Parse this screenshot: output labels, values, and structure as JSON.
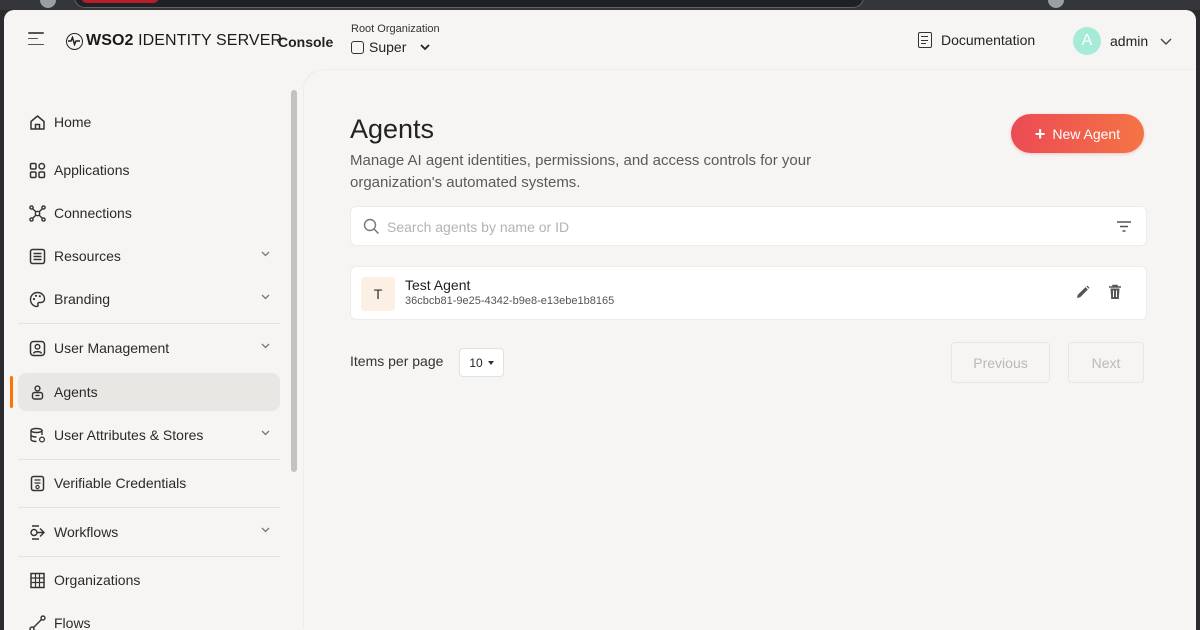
{
  "header": {
    "brand_strong": "WSO2",
    "brand_light": "IDENTITY SERVER",
    "console_label": "Console",
    "org_caption": "Root Organization",
    "org_name": "Super",
    "documentation_label": "Documentation",
    "avatar_initial": "A",
    "user_name": "admin"
  },
  "sidebar": {
    "items": [
      {
        "label": "Home",
        "icon": "home-icon"
      },
      {
        "label": "Applications",
        "icon": "grid-icon"
      },
      {
        "label": "Connections",
        "icon": "connections-icon"
      },
      {
        "label": "Resources",
        "icon": "list-icon"
      },
      {
        "label": "Branding",
        "icon": "palette-icon"
      },
      {
        "label": "User Management",
        "icon": "user-icon"
      },
      {
        "label": "Agents",
        "icon": "agent-icon"
      },
      {
        "label": "User Attributes & Stores",
        "icon": "database-icon"
      },
      {
        "label": "Verifiable Credentials",
        "icon": "credential-icon"
      },
      {
        "label": "Workflows",
        "icon": "workflow-icon"
      },
      {
        "label": "Organizations",
        "icon": "building-icon"
      },
      {
        "label": "Flows",
        "icon": "flow-icon"
      }
    ],
    "active": "Agents"
  },
  "main": {
    "title": "Agents",
    "description": "Manage AI agent identities, permissions, and access controls for your organization's automated systems.",
    "new_button_label": "New Agent",
    "search_placeholder": "Search agents by name or ID",
    "agents": [
      {
        "initial": "T",
        "name": "Test Agent",
        "id": "36cbcb81-9e25-4342-b9e8-e13ebe1b8165"
      }
    ],
    "items_per_page_label": "Items per page",
    "items_per_page_value": "10",
    "previous_label": "Previous",
    "next_label": "Next"
  },
  "colors": {
    "accent_gradient_start": "#ec4a54",
    "accent_gradient_end": "#f47444",
    "active_indicator": "#ff7300",
    "avatar_bg": "#a6ead8"
  }
}
